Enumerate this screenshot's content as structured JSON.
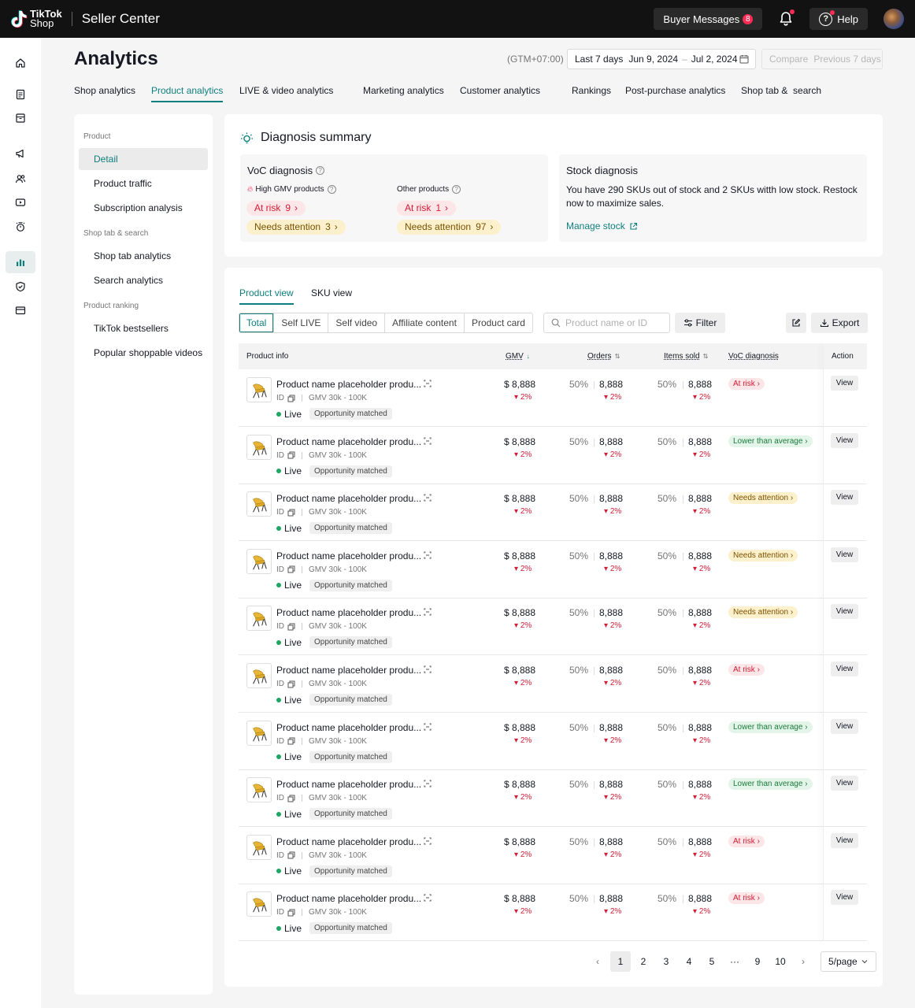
{
  "topbar": {
    "logo_line1": "TikTok",
    "logo_line2": "Shop",
    "app_title": "Seller Center",
    "buyer_messages_label": "Buyer Messages",
    "buyer_messages_count": "8",
    "help_label": "Help"
  },
  "rail": {
    "items": [
      "home-icon",
      "orders-icon",
      "products-icon",
      "marketing-icon",
      "customers-icon",
      "video-icon",
      "growth-icon",
      "analytics-icon",
      "shield-icon",
      "finance-icon"
    ],
    "active": "analytics-icon"
  },
  "header": {
    "title": "Analytics",
    "timezone": "(GTM+07:00)",
    "date_label": "Last 7 days",
    "date_start": "Jun 9, 2024",
    "date_sep": "–",
    "date_end": "Jul 2, 2024",
    "compare_label": "Compare",
    "compare_value": "Previous 7 days"
  },
  "tabs": [
    {
      "label": "Shop analytics"
    },
    {
      "label": "Product analytics"
    },
    {
      "label": "LIVE & video analytics"
    },
    {
      "label": "Marketing analytics"
    },
    {
      "label": "Customer analytics"
    },
    {
      "label": "Rankings"
    },
    {
      "label": "Post-purchase analytics"
    },
    {
      "label": "Shop tab &  search"
    }
  ],
  "sidenav": {
    "group_product": "Product",
    "detail": "Detail",
    "product_traffic": "Product traffic",
    "subscription": "Subscription analysis",
    "group_shoptab": "Shop tab & search",
    "shoptab_analytics": "Shop tab analytics",
    "search_analytics": "Search analytics",
    "group_ranking": "Product ranking",
    "bestsellers": "TikTok bestsellers",
    "popular_videos": "Popular shoppable videos"
  },
  "diagnosis": {
    "title": "Diagnosis summary",
    "voc_title": "VoC diagnosis",
    "high_gmv_label": "High GMV products",
    "other_label": "Other products",
    "at_risk_label": "At risk",
    "needs_attention_label": "Needs attention",
    "high_gmv_at_risk": "9",
    "high_gmv_needs_attention": "3",
    "other_at_risk": "1",
    "other_needs_attention": "97",
    "stock_title": "Stock diagnosis",
    "stock_text": "You have 290 SKUs out of stock and 2 SKUs witth low stock. Restock now to maximize sales.",
    "manage_stock": "Manage stock"
  },
  "product_card": {
    "view_tabs": [
      "Product view",
      "SKU view"
    ],
    "segments": [
      "Total",
      "Self LIVE",
      "Self video",
      "Affiliate content",
      "Product card"
    ],
    "search_placeholder": "Product name or ID",
    "filter_label": "Filter",
    "export_label": "Export",
    "columns": {
      "product_info": "Product info",
      "gmv": "GMV",
      "orders": "Orders",
      "items_sold": "Items sold",
      "voc": "VoC diagnosis",
      "action": "Action"
    },
    "rows": [
      {
        "name": "Product name placeholder produ...",
        "id": "ID",
        "gmv_range": "GMV 30k - 100K",
        "status": "Live",
        "tag": "Opportunity matched",
        "gmv": "$ 8,888",
        "gmv_delta": "2%",
        "orders_pct": "50%",
        "orders": "8,888",
        "orders_delta": "2%",
        "items_pct": "50%",
        "items": "8,888",
        "items_delta": "2%",
        "voc": "At risk",
        "voc_type": "risk",
        "action": "View"
      },
      {
        "name": "Product name placeholder produ...",
        "id": "ID",
        "gmv_range": "GMV 30k - 100K",
        "status": "Live",
        "tag": "Opportunity matched",
        "gmv": "$ 8,888",
        "gmv_delta": "2%",
        "orders_pct": "50%",
        "orders": "8,888",
        "orders_delta": "2%",
        "items_pct": "50%",
        "items": "8,888",
        "items_delta": "2%",
        "voc": "Lower than average",
        "voc_type": "low",
        "action": "View"
      },
      {
        "name": "Product name placeholder produ...",
        "id": "ID",
        "gmv_range": "GMV 30k - 100K",
        "status": "Live",
        "tag": "Opportunity matched",
        "gmv": "$ 8,888",
        "gmv_delta": "2%",
        "orders_pct": "50%",
        "orders": "8,888",
        "orders_delta": "2%",
        "items_pct": "50%",
        "items": "8,888",
        "items_delta": "2%",
        "voc": "Needs attention",
        "voc_type": "attn",
        "action": "View"
      },
      {
        "name": "Product name placeholder produ...",
        "id": "ID",
        "gmv_range": "GMV 30k - 100K",
        "status": "Live",
        "tag": "Opportunity matched",
        "gmv": "$ 8,888",
        "gmv_delta": "2%",
        "orders_pct": "50%",
        "orders": "8,888",
        "orders_delta": "2%",
        "items_pct": "50%",
        "items": "8,888",
        "items_delta": "2%",
        "voc": "Needs attention",
        "voc_type": "attn",
        "action": "View"
      },
      {
        "name": "Product name placeholder produ...",
        "id": "ID",
        "gmv_range": "GMV 30k - 100K",
        "status": "Live",
        "tag": "Opportunity matched",
        "gmv": "$ 8,888",
        "gmv_delta": "2%",
        "orders_pct": "50%",
        "orders": "8,888",
        "orders_delta": "2%",
        "items_pct": "50%",
        "items": "8,888",
        "items_delta": "2%",
        "voc": "Needs attention",
        "voc_type": "attn",
        "action": "View"
      },
      {
        "name": "Product name placeholder produ...",
        "id": "ID",
        "gmv_range": "GMV 30k - 100K",
        "status": "Live",
        "tag": "Opportunity matched",
        "gmv": "$ 8,888",
        "gmv_delta": "2%",
        "orders_pct": "50%",
        "orders": "8,888",
        "orders_delta": "2%",
        "items_pct": "50%",
        "items": "8,888",
        "items_delta": "2%",
        "voc": "At risk",
        "voc_type": "risk",
        "action": "View"
      },
      {
        "name": "Product name placeholder produ...",
        "id": "ID",
        "gmv_range": "GMV 30k - 100K",
        "status": "Live",
        "tag": "Opportunity matched",
        "gmv": "$ 8,888",
        "gmv_delta": "2%",
        "orders_pct": "50%",
        "orders": "8,888",
        "orders_delta": "2%",
        "items_pct": "50%",
        "items": "8,888",
        "items_delta": "2%",
        "voc": "Lower than average",
        "voc_type": "low",
        "action": "View"
      },
      {
        "name": "Product name placeholder produ...",
        "id": "ID",
        "gmv_range": "GMV 30k - 100K",
        "status": "Live",
        "tag": "Opportunity matched",
        "gmv": "$ 8,888",
        "gmv_delta": "2%",
        "orders_pct": "50%",
        "orders": "8,888",
        "orders_delta": "2%",
        "items_pct": "50%",
        "items": "8,888",
        "items_delta": "2%",
        "voc": "Lower than average",
        "voc_type": "low",
        "action": "View"
      },
      {
        "name": "Product name placeholder produ...",
        "id": "ID",
        "gmv_range": "GMV 30k - 100K",
        "status": "Live",
        "tag": "Opportunity matched",
        "gmv": "$ 8,888",
        "gmv_delta": "2%",
        "orders_pct": "50%",
        "orders": "8,888",
        "orders_delta": "2%",
        "items_pct": "50%",
        "items": "8,888",
        "items_delta": "2%",
        "voc": "At risk",
        "voc_type": "risk",
        "action": "View"
      },
      {
        "name": "Product name placeholder produ...",
        "id": "ID",
        "gmv_range": "GMV 30k - 100K",
        "status": "Live",
        "tag": "Opportunity matched",
        "gmv": "$ 8,888",
        "gmv_delta": "2%",
        "orders_pct": "50%",
        "orders": "8,888",
        "orders_delta": "2%",
        "items_pct": "50%",
        "items": "8,888",
        "items_delta": "2%",
        "voc": "At risk",
        "voc_type": "risk",
        "action": "View"
      }
    ],
    "pagination": {
      "pages": [
        "1",
        "2",
        "3",
        "4",
        "5",
        "···",
        "9",
        "10"
      ],
      "current": "1",
      "page_size": "5/page"
    }
  },
  "colors": {
    "accent": "#0e7f7d",
    "danger": "#d41b35",
    "topbar": "#121212"
  }
}
